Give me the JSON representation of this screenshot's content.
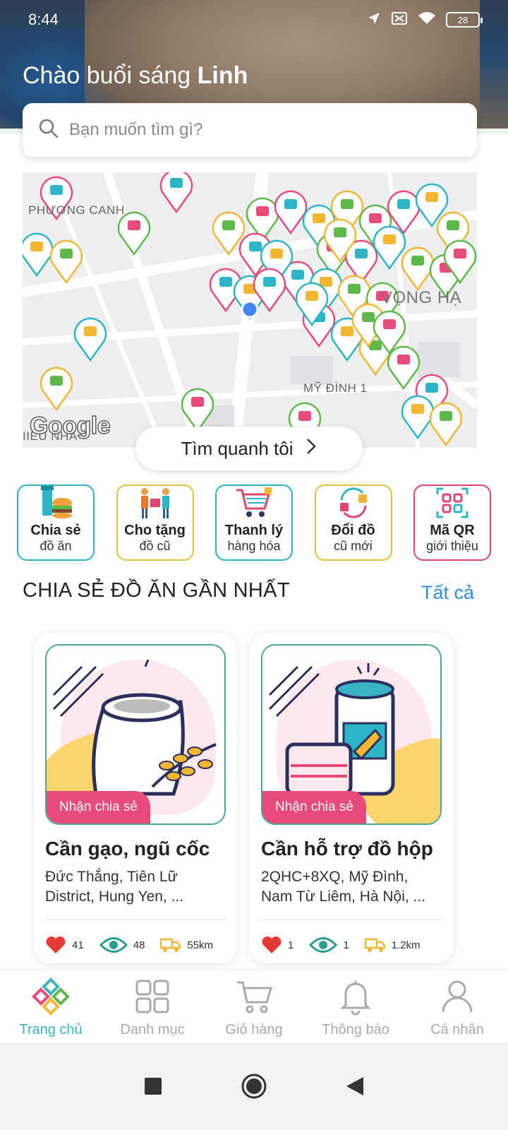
{
  "status": {
    "time": "8:44",
    "battery": "28"
  },
  "greeting": {
    "prefix": "Chào buổi sáng",
    "name": "Linh"
  },
  "search": {
    "placeholder": "Bạn muốn tìm gì?"
  },
  "map": {
    "labels": [
      "PHƯƠNG CANH",
      "VỌNG HẠ",
      "MỸ ĐÌNH 1",
      "IIEU NHA"
    ],
    "brand": "Google",
    "near_button": "Tìm quanh tôi"
  },
  "categories": [
    {
      "line1": "Chia sẻ",
      "line2": "đồ ăn",
      "icon": "food-share-icon"
    },
    {
      "line1": "Cho tặng",
      "line2": "đồ cũ",
      "icon": "gift-icon"
    },
    {
      "line1": "Thanh lý",
      "line2": "hàng hóa",
      "icon": "cart-icon"
    },
    {
      "line1": "Đổi đồ",
      "line2": "cũ mới",
      "icon": "exchange-icon"
    },
    {
      "line1": "Mã QR",
      "line2": "giới thiệu",
      "icon": "qr-code-icon"
    }
  ],
  "section": {
    "title": "CHIA SẺ ĐỒ ĂN GẦN NHẤT",
    "see_all": "Tất cả"
  },
  "cards": [
    {
      "badge": "Nhận chia sẻ",
      "title": "Cần gạo, ngũ cốc",
      "address": "Đức Thắng, Tiên Lữ District, Hung Yen, ...",
      "likes": "41",
      "views": "48",
      "distance": "55km"
    },
    {
      "badge": "Nhận chia sẻ",
      "title": "Cần hỗ trợ đồ hộp",
      "address": "2QHC+8XQ, Mỹ Đình, Nam Từ Liêm, Hà Nội, ...",
      "likes": "1",
      "views": "1",
      "distance": "1.2km"
    }
  ],
  "nav": [
    {
      "label": "Trang chủ",
      "icon": "home-logo-icon",
      "active": true
    },
    {
      "label": "Danh mục",
      "icon": "grid-icon"
    },
    {
      "label": "Giỏ hàng",
      "icon": "cart-icon"
    },
    {
      "label": "Thông báo",
      "icon": "bell-icon"
    },
    {
      "label": "Cá nhân",
      "icon": "user-icon"
    }
  ],
  "colors": {
    "accent": "#3ab3c4",
    "link": "#2f8de4",
    "badge": "#e84a79",
    "heart": "#e53935",
    "eye": "#2a9d8f",
    "truck": "#f2b732"
  }
}
